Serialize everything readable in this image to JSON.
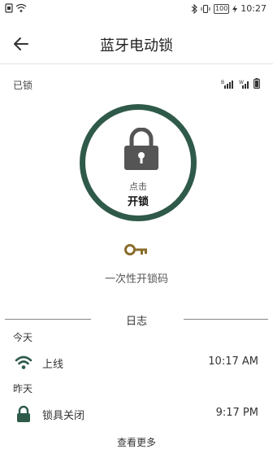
{
  "status_bar": {
    "battery_percent": "100",
    "time": "10:27"
  },
  "header": {
    "title": "蓝牙电动锁"
  },
  "lock": {
    "state": "已锁",
    "tap_label": "点击",
    "action_label": "开锁",
    "ring_color": "#2f5a4a"
  },
  "otp": {
    "label": "一次性开锁码",
    "icon_color": "#8a6d2c"
  },
  "log": {
    "title": "日志",
    "groups": [
      {
        "day": "今天",
        "entries": [
          {
            "icon": "wifi-icon",
            "text": "上线",
            "time": "10:17 AM"
          }
        ]
      },
      {
        "day": "昨天",
        "entries": [
          {
            "icon": "lock-icon",
            "text": "锁具关闭",
            "time": "9:17 PM"
          }
        ]
      }
    ],
    "more_label": "查看更多"
  },
  "colors": {
    "accent": "#2f5a4a",
    "gold": "#8a6d2c"
  }
}
